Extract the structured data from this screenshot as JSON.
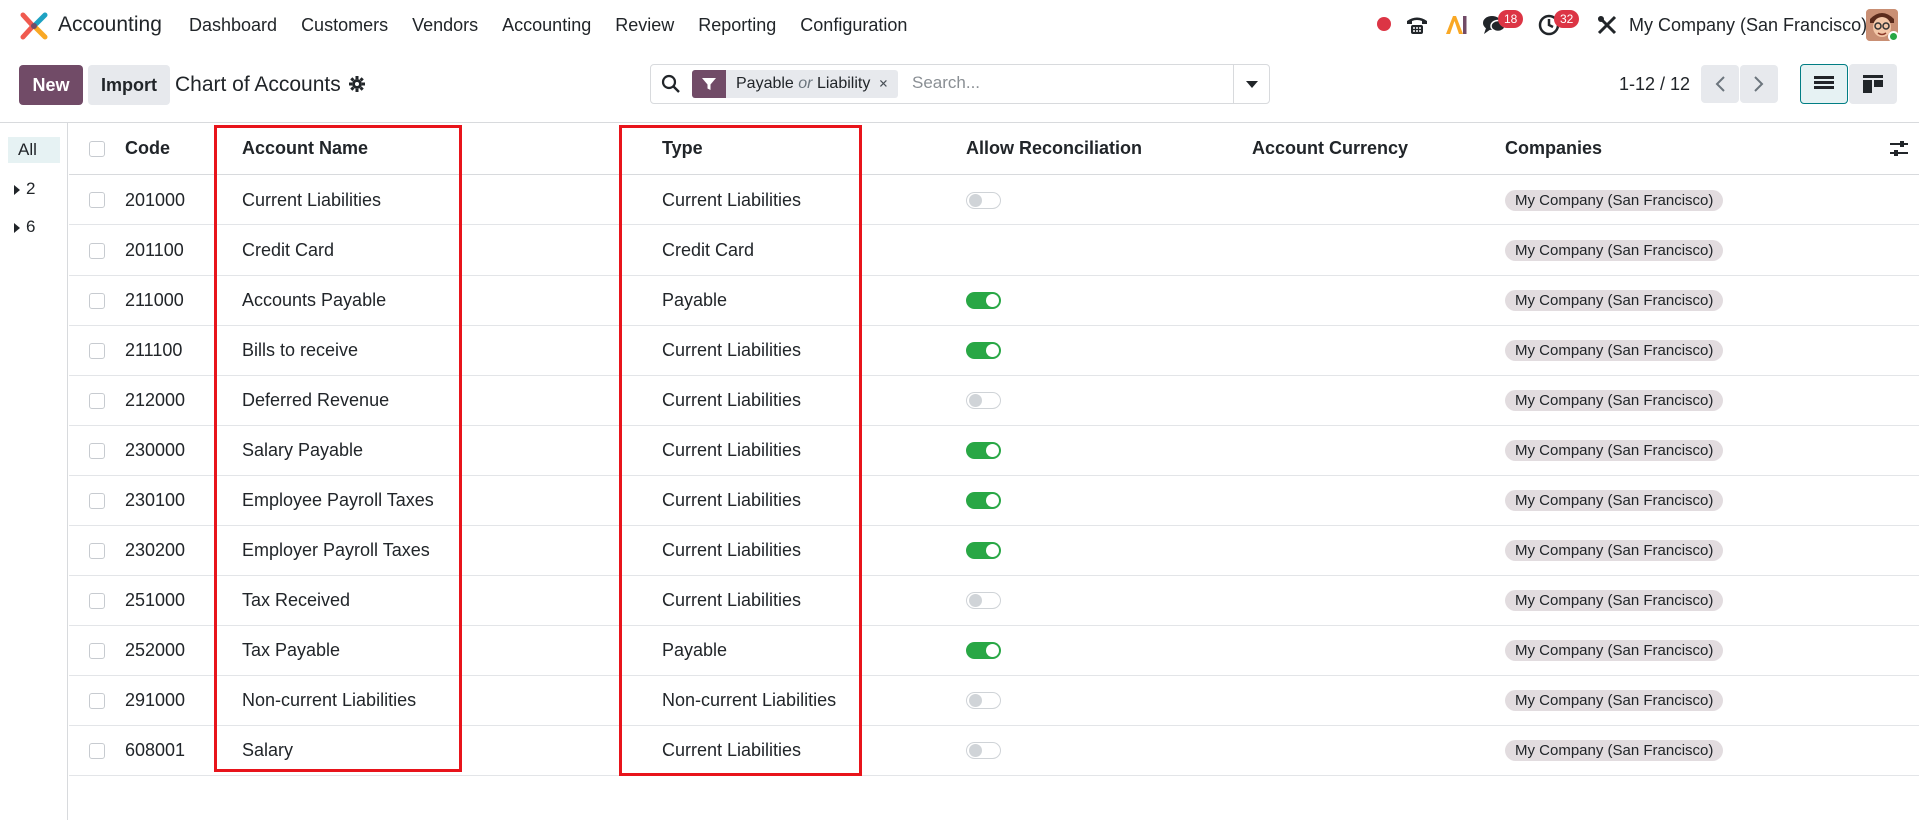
{
  "navbar": {
    "app_name": "Accounting",
    "menu": [
      "Dashboard",
      "Customers",
      "Vendors",
      "Accounting",
      "Review",
      "Reporting",
      "Configuration"
    ],
    "messages_badge": "18",
    "activities_badge": "32",
    "company": "My Company (San Francisco)"
  },
  "control": {
    "new_label": "New",
    "import_label": "Import",
    "title": "Chart of Accounts",
    "facet_a": "Payable",
    "facet_or": "or",
    "facet_b": "Liability",
    "search_placeholder": "Search...",
    "pager": "1-12 / 12"
  },
  "sidepanel": {
    "all_label": "All",
    "groups": [
      "2",
      "6"
    ]
  },
  "table": {
    "headers": {
      "code": "Code",
      "name": "Account Name",
      "type": "Type",
      "reconcile": "Allow Reconciliation",
      "currency": "Account Currency",
      "companies": "Companies"
    },
    "rows": [
      {
        "code": "201000",
        "name": "Current Liabilities",
        "type": "Current Liabilities",
        "reconcile": "off",
        "company": "My Company (San Francisco)"
      },
      {
        "code": "201100",
        "name": "Credit Card",
        "type": "Credit Card",
        "reconcile": "none",
        "company": "My Company (San Francisco)"
      },
      {
        "code": "211000",
        "name": "Accounts Payable",
        "type": "Payable",
        "reconcile": "on",
        "company": "My Company (San Francisco)"
      },
      {
        "code": "211100",
        "name": "Bills to receive",
        "type": "Current Liabilities",
        "reconcile": "on",
        "company": "My Company (San Francisco)"
      },
      {
        "code": "212000",
        "name": "Deferred Revenue",
        "type": "Current Liabilities",
        "reconcile": "off",
        "company": "My Company (San Francisco)"
      },
      {
        "code": "230000",
        "name": "Salary Payable",
        "type": "Current Liabilities",
        "reconcile": "on",
        "company": "My Company (San Francisco)"
      },
      {
        "code": "230100",
        "name": "Employee Payroll Taxes",
        "type": "Current Liabilities",
        "reconcile": "on",
        "company": "My Company (San Francisco)"
      },
      {
        "code": "230200",
        "name": "Employer Payroll Taxes",
        "type": "Current Liabilities",
        "reconcile": "on",
        "company": "My Company (San Francisco)"
      },
      {
        "code": "251000",
        "name": "Tax Received",
        "type": "Current Liabilities",
        "reconcile": "off",
        "company": "My Company (San Francisco)"
      },
      {
        "code": "252000",
        "name": "Tax Payable",
        "type": "Payable",
        "reconcile": "on",
        "company": "My Company (San Francisco)"
      },
      {
        "code": "291000",
        "name": "Non-current Liabilities",
        "type": "Non-current Liabilities",
        "reconcile": "off",
        "company": "My Company (San Francisco)"
      },
      {
        "code": "608001",
        "name": "Salary",
        "type": "Current Liabilities",
        "reconcile": "off",
        "company": "My Company (San Francisco)"
      }
    ]
  },
  "colors": {
    "brand": "#714b67",
    "toggle_on": "#28a745",
    "annotation": "#e8141b",
    "badge": "#dc3545"
  }
}
